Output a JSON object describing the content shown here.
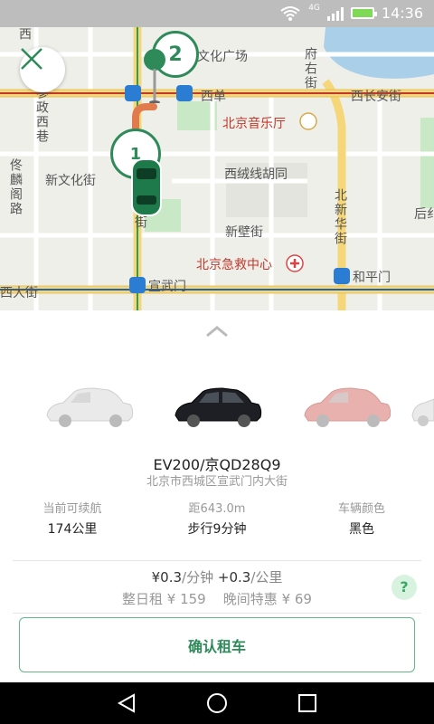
{
  "status_bar": {
    "time": "14:36",
    "network": "4G"
  },
  "map": {
    "labels": {
      "xi_vertical": "西",
      "wenhua_square": "文化广场",
      "fuyoujie": "府右街",
      "canzheng_xixiang": "参政西巷",
      "xidan": "西单",
      "xichang_anjie": "西长安街",
      "beijing_concert_hall": "北京音乐厅",
      "xinwenhua_jie": "新文化街",
      "xirongxian_hutong": "西绒线胡同",
      "zuolin_ge_road": "佟麟阁路",
      "beixinhua_jie": "北新华街",
      "hou_edge": "后纟",
      "xinbi_jie": "新壁街",
      "emergency_center": "北京急救中心",
      "xida_jie": "西大街",
      "xuanwumen": "宣武门",
      "hepingmen": "和平门",
      "jie_edge": "街"
    },
    "pin_count": "2",
    "pin_count_small": "1"
  },
  "vehicle": {
    "plate_title": "EV200/京QD28Q9",
    "address": "北京市西城区宣武门内大街",
    "stats": [
      {
        "label": "当前可续航",
        "value": "174公里"
      },
      {
        "label": "距643.0m",
        "value": "步行9分钟"
      },
      {
        "label": "车辆颜色",
        "value": "黑色"
      }
    ]
  },
  "pricing": {
    "per_minute": "¥0.3",
    "per_minute_unit": "/分钟",
    "plus": "+",
    "per_km": "0.3",
    "per_km_unit": "/公里",
    "line2": "整日租 ¥ 159    晚间特惠 ¥ 69",
    "help_label": "?"
  },
  "actions": {
    "confirm_label": "确认租车"
  },
  "colors": {
    "brand_green": "#2f8a5a",
    "route_orange": "#e07b4e",
    "road_yellow": "#f5d77a",
    "water_blue": "#a9cfe9",
    "metro_line": "#1f63b5"
  }
}
